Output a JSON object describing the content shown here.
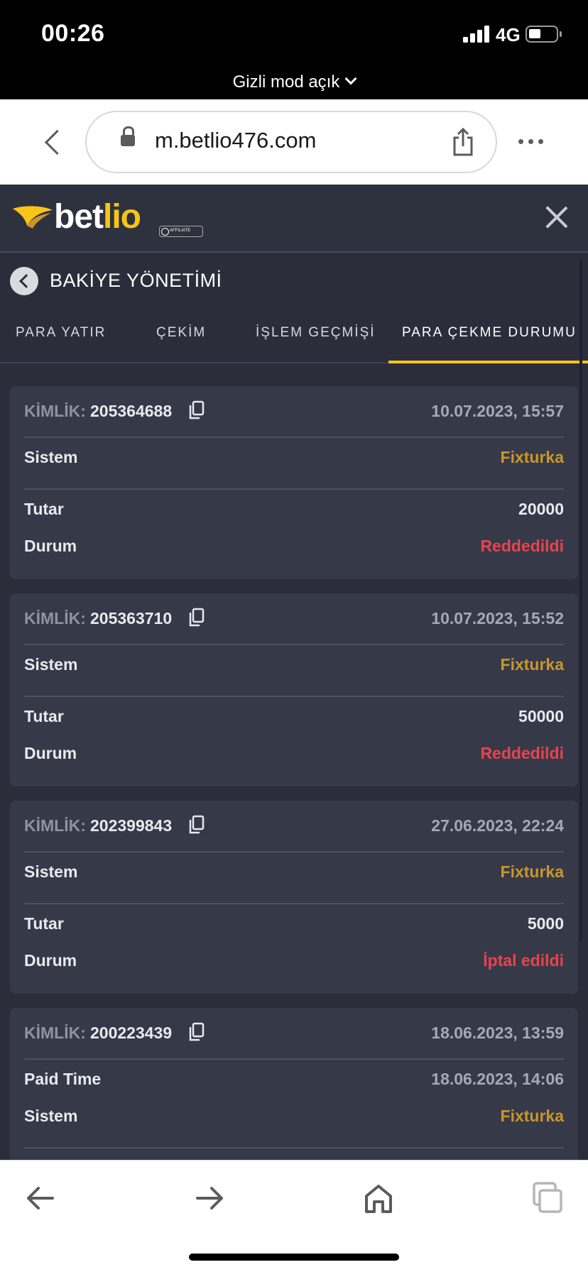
{
  "status_bar": {
    "time": "00:26",
    "network": "4G",
    "private_mode": "Gizli mod açık"
  },
  "browser": {
    "url": "m.betlio476.com"
  },
  "brand": {
    "logo_white": "bet",
    "logo_yellow": "lio",
    "badge": "AFFILIATE",
    "accent": "#f5c518"
  },
  "section": {
    "title": "BAKİYE YÖNETİMİ"
  },
  "tabs": [
    {
      "label": "PARA YATIR"
    },
    {
      "label": "ÇEKİM"
    },
    {
      "label": "İŞLEM GEÇMİŞİ"
    },
    {
      "label": "PARA ÇEKME DURUMU",
      "active": true
    }
  ],
  "labels": {
    "kimlik": "KİMLİK:",
    "sistem": "Sistem",
    "tutar": "Tutar",
    "durum": "Durum",
    "paid_time": "Paid Time"
  },
  "transactions": [
    {
      "id": "205364688",
      "date": "10.07.2023, 15:57",
      "system": "Fixturka",
      "amount": "20000",
      "status": "Reddedildi"
    },
    {
      "id": "205363710",
      "date": "10.07.2023, 15:52",
      "system": "Fixturka",
      "amount": "50000",
      "status": "Reddedildi"
    },
    {
      "id": "202399843",
      "date": "27.06.2023, 22:24",
      "system": "Fixturka",
      "amount": "5000",
      "status": "İptal edildi"
    },
    {
      "id": "200223439",
      "date": "18.06.2023, 13:59",
      "paid_time": "18.06.2023, 14:06",
      "system": "Fixturka"
    }
  ],
  "colors": {
    "system": "#c9962b",
    "status_rejected": "#e8434e",
    "background": "#2b2e3a",
    "card": "#363948"
  }
}
